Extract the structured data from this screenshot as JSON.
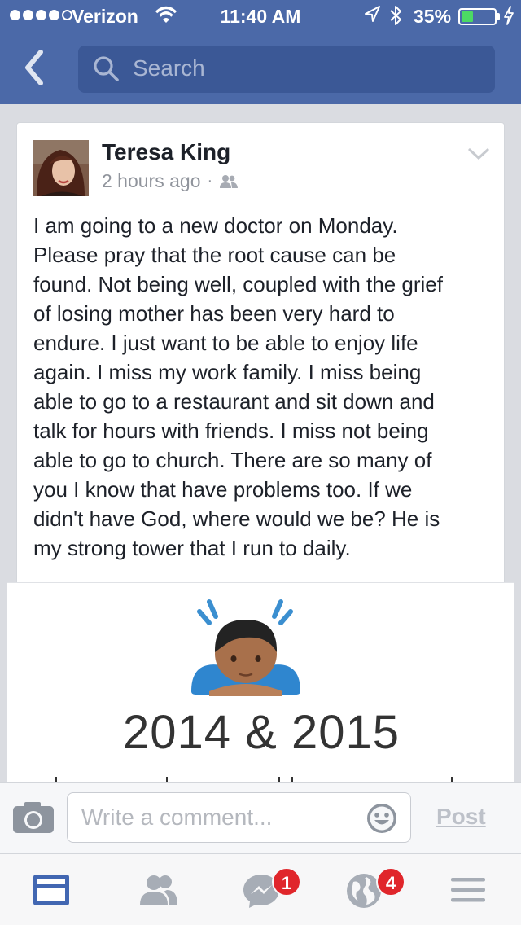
{
  "status_bar": {
    "carrier": "Verizon",
    "time": "11:40 AM",
    "battery_percent": "35%",
    "battery_level": 0.35,
    "signal_bars": 4
  },
  "nav": {
    "back_icon": "chevron-left-icon",
    "search_placeholder": "Search"
  },
  "post": {
    "author": "Teresa King",
    "time_ago": "2 hours ago",
    "separator": "·",
    "audience_icon": "friends-icon",
    "text_lines": [
      "I am going to a new doctor on Monday.",
      "Please pray that the root cause can be",
      "found. Not being well, coupled with the grief",
      "of losing mother has been very hard to",
      "endure. I just want to be able to enjoy life",
      "again. I miss my work family. I miss being",
      "able to go to a restaurant and sit down and",
      "talk for hours with friends. I miss not being",
      "able to go to church. There are so many of",
      "you I know that have problems too. If we",
      "didn't have God, where would we be? He is",
      "my strong tower that I run to daily."
    ],
    "shared_image_caption": "2014 & 2015"
  },
  "composer": {
    "placeholder": "Write a comment...",
    "post_label": "Post"
  },
  "tabbar": {
    "tabs": [
      {
        "icon": "news-feed-icon",
        "active": true
      },
      {
        "icon": "friend-requests-icon",
        "active": false
      },
      {
        "icon": "messenger-icon",
        "active": false,
        "badge": "1"
      },
      {
        "icon": "notifications-globe-icon",
        "active": false,
        "badge": "4"
      },
      {
        "icon": "menu-icon",
        "active": false
      }
    ]
  },
  "colors": {
    "brand_blue": "#4b69a8",
    "search_bg": "#3b5896",
    "active_tab": "#4267b2",
    "badge_red": "#e0262b"
  }
}
